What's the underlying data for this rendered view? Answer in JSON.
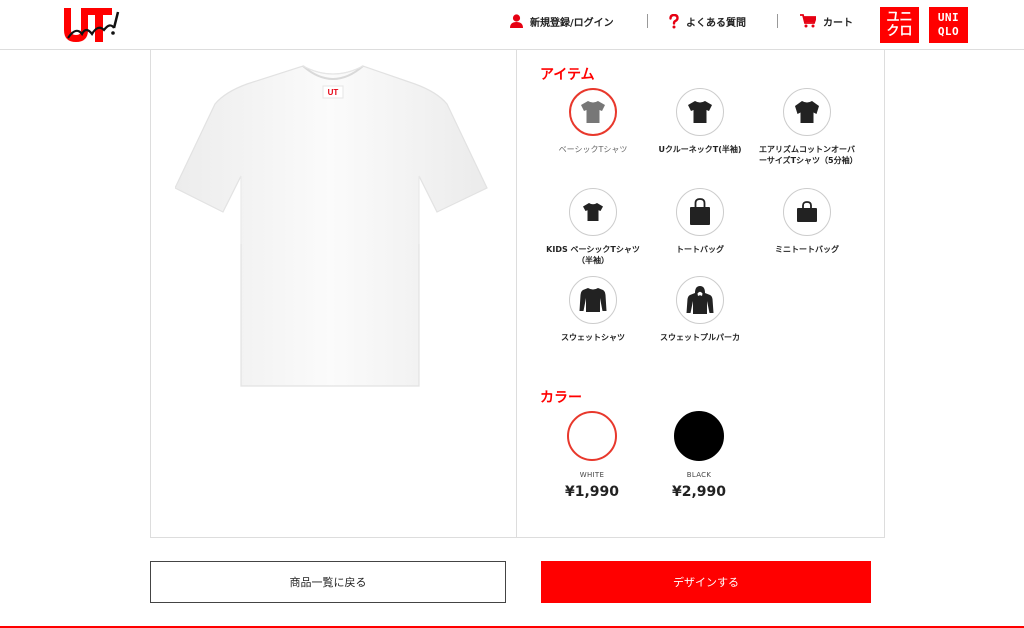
{
  "header": {
    "logo_alt": "UT me!",
    "login_label": "新規登録/ログイン",
    "faq_label": "よくある質問",
    "cart_label": "カート",
    "uniqlo_kana_top": "ユニ",
    "uniqlo_kana_bottom": "クロ",
    "uniqlo_latin_top": "UNI",
    "uniqlo_latin_bottom": "QLO"
  },
  "items_section": {
    "title": "アイテム",
    "items": [
      {
        "label": "ベーシックTシャツ",
        "icon": "tshirt-icon",
        "selected": true
      },
      {
        "label": "UクルーネックT(半袖)",
        "icon": "tshirt-icon",
        "selected": false
      },
      {
        "label": "エアリズムコットンオーバーサイズTシャツ（5分袖）",
        "icon": "tshirt-icon",
        "selected": false
      },
      {
        "label": "KIDS ベーシックTシャツ（半袖）",
        "icon": "kids-tshirt-icon",
        "selected": false
      },
      {
        "label": "トートバッグ",
        "icon": "tote-bag-icon",
        "selected": false
      },
      {
        "label": "ミニトートバッグ",
        "icon": "mini-tote-bag-icon",
        "selected": false
      },
      {
        "label": "スウェットシャツ",
        "icon": "sweatshirt-icon",
        "selected": false
      },
      {
        "label": "スウェットプルパーカ",
        "icon": "hoodie-icon",
        "selected": false
      }
    ]
  },
  "colors_section": {
    "title": "カラー",
    "colors": [
      {
        "name": "WHITE",
        "price": "¥1,990",
        "hex": "#ffffff",
        "selected": true
      },
      {
        "name": "BLACK",
        "price": "¥2,990",
        "hex": "#000000",
        "selected": false
      }
    ]
  },
  "buttons": {
    "back_label": "商品一覧に戻る",
    "design_label": "デザインする"
  },
  "colors": {
    "accent": "#ff0000",
    "selected_ring": "#e8382c"
  }
}
